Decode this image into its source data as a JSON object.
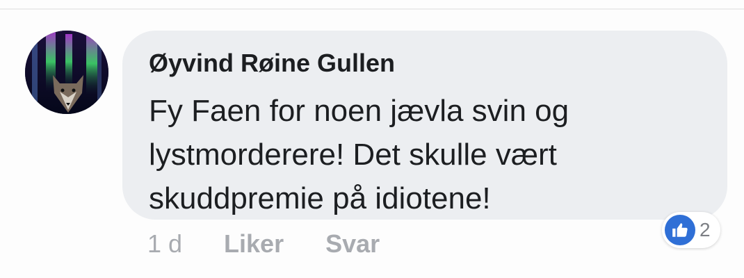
{
  "comment": {
    "author": "Øyvind Røine Gullen",
    "lines": [
      "Fy Faen for noen jævla svin og",
      "lystmorderere! Det skulle vært",
      "skuddpremie på idiotene!"
    ],
    "avatar_icon": "wolf-aurora-avatar"
  },
  "actions": {
    "timestamp": "1 d",
    "like_label": "Liker",
    "reply_label": "Svar"
  },
  "reactions": {
    "icon": "thumbs-up-icon",
    "count": "2",
    "color": "#2f6fd6"
  },
  "colors": {
    "bubble": "#eceef1",
    "text": "#1c1e21",
    "muted": "#a8abb0"
  }
}
